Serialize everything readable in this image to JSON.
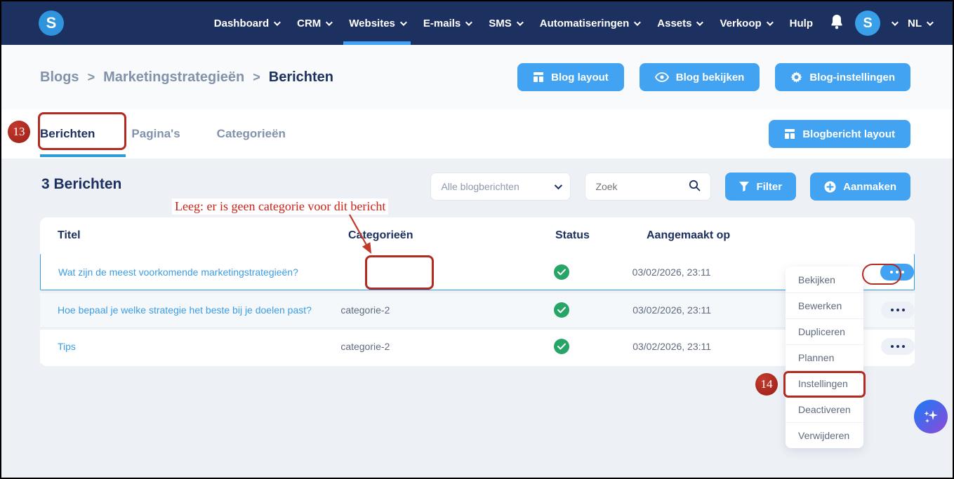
{
  "nav": {
    "logo_text": "S",
    "items": [
      {
        "label": "Dashboard"
      },
      {
        "label": "CRM"
      },
      {
        "label": "Websites"
      },
      {
        "label": "E-mails"
      },
      {
        "label": "SMS"
      },
      {
        "label": "Automatiseringen"
      },
      {
        "label": "Assets"
      },
      {
        "label": "Verkoop"
      },
      {
        "label": "Hulp"
      }
    ],
    "active_item": "Websites",
    "avatar_text": "S",
    "locale": "NL"
  },
  "breadcrumb": {
    "separator": ">",
    "items": [
      {
        "label": "Blogs"
      },
      {
        "label": "Marketingstrategieën"
      },
      {
        "label": "Berichten"
      }
    ]
  },
  "header_buttons": {
    "layout": "Blog layout",
    "view": "Blog bekijken",
    "settings": "Blog-instellingen"
  },
  "tabs": {
    "berichten": "Berichten",
    "paginas": "Pagina's",
    "categorieen": "Categorieën",
    "layout_button": "Blogbericht layout"
  },
  "content": {
    "count_title": "3 Berichten",
    "filter_select_value": "Alle blogberichten",
    "search_placeholder": "Zoek",
    "filter_button": "Filter",
    "create_button": "Aanmaken"
  },
  "table": {
    "columns": {
      "title": "Titel",
      "category": "Categorieën",
      "status": "Status",
      "created": "Aangemaakt op"
    },
    "rows": [
      {
        "title": "Wat zijn de meest voorkomende marketingstrategieën?",
        "category": "",
        "status": "published",
        "created": "03/02/2026, 23:11"
      },
      {
        "title": "Hoe bepaal je welke strategie het beste bij je doelen past?",
        "category": "categorie-2",
        "status": "published",
        "created": "03/02/2026, 23:11"
      },
      {
        "title": "Tips",
        "category": "categorie-2",
        "status": "published",
        "created": "03/02/2026, 23:11"
      }
    ]
  },
  "context_menu": {
    "items": [
      "Bekijken",
      "Bewerken",
      "Dupliceren",
      "Plannen",
      "Instellingen",
      "Deactiveren",
      "Verwijderen"
    ],
    "highlighted": "Instellingen"
  },
  "annotations": {
    "step_13": "13",
    "step_14": "14",
    "note": "Leeg: er is geen categorie voor dit bericht"
  },
  "colors": {
    "navbar": "#1d3160",
    "accent_blue": "#42a3f2",
    "link_blue": "#3b9de4",
    "heading_navy": "#1d3160",
    "status_green": "#27a567",
    "annotation_red": "#b22a20"
  }
}
